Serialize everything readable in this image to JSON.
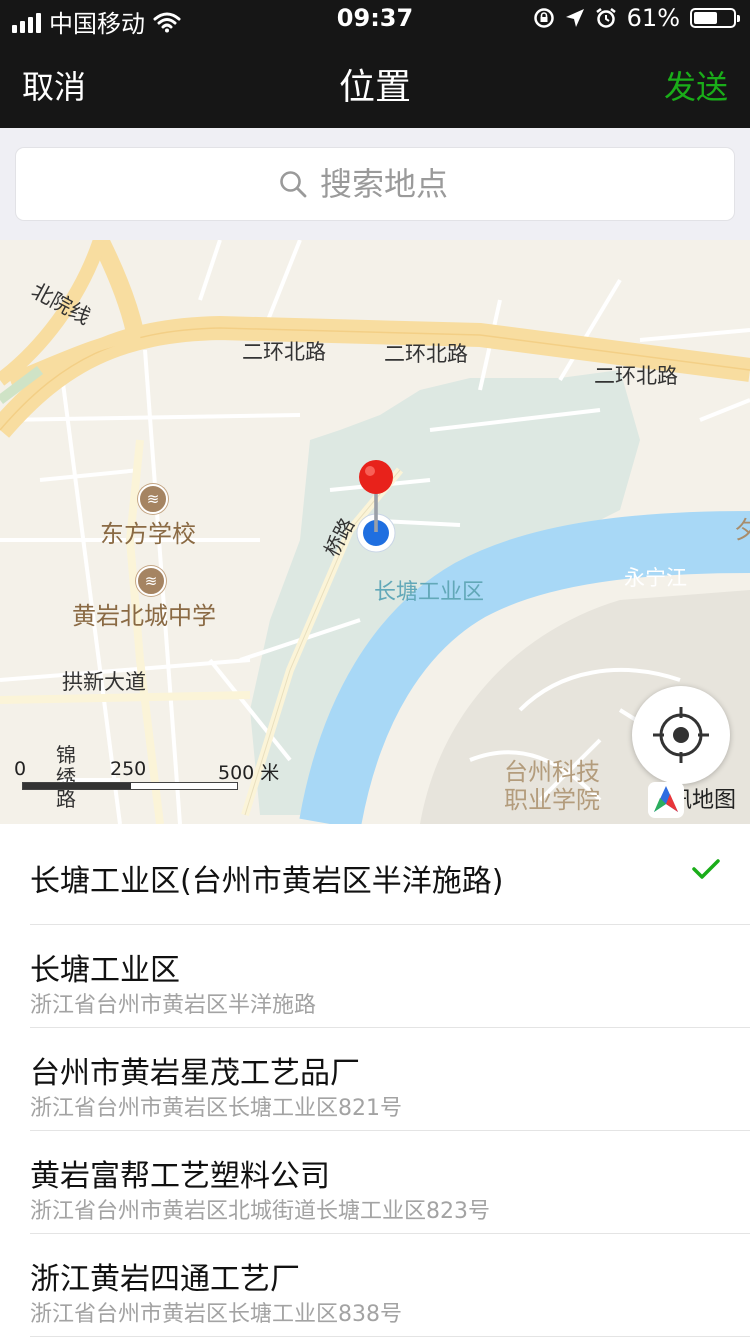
{
  "status_bar": {
    "carrier": "中国移动",
    "time": "09:37",
    "battery": "61%",
    "battery_level": 0.61
  },
  "nav": {
    "cancel_label": "取消",
    "title": "位置",
    "send_label": "发送",
    "send_color": "#1aad19"
  },
  "search": {
    "placeholder": "搜索地点",
    "icon": "search-icon"
  },
  "map": {
    "roads": [
      "北院线",
      "二环北路",
      "二环北路",
      "二环北路",
      "拱新大道",
      "锦绣路"
    ],
    "partial_road": "桥路",
    "pois": [
      "东方学校",
      "黄岩北城中学",
      "台州科技职业学院"
    ],
    "area": "长塘工业区",
    "river": "永宁江",
    "edge_char": "夕",
    "scale": {
      "zero": "0",
      "mid": "250",
      "end": "500 米"
    },
    "brand": "腾讯地图",
    "pin_color": "#e8221b",
    "location_color": "#1f6fe0",
    "water_color": "#a8d8f6"
  },
  "list": [
    {
      "title": "长塘工业区(台州市黄岩区半洋施路)",
      "selected": true
    },
    {
      "title": "长塘工业区",
      "subtitle": "浙江省台州市黄岩区半洋施路"
    },
    {
      "title": "台州市黄岩星茂工艺品厂",
      "subtitle": "浙江省台州市黄岩区长塘工业区821号"
    },
    {
      "title": "黄岩富帮工艺塑料公司",
      "subtitle": "浙江省台州市黄岩区北城街道长塘工业区823号"
    },
    {
      "title": "浙江黄岩四通工艺厂",
      "subtitle": "浙江省台州市黄岩区长塘工业区838号"
    }
  ]
}
